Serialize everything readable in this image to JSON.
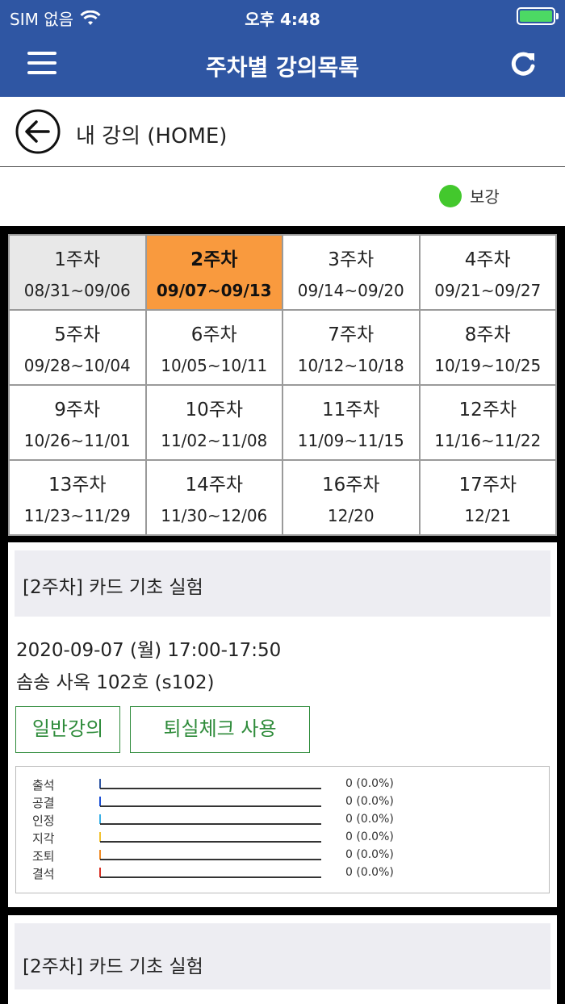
{
  "status_bar": {
    "carrier": "SIM 없음",
    "time": "오후 4:48",
    "battery_level": 1.0,
    "icons": [
      "wifi-icon",
      "battery-icon"
    ]
  },
  "navbar": {
    "title": "주차별 강의목록",
    "icons": [
      "menu-icon",
      "refresh-icon"
    ]
  },
  "back": {
    "label": "내 강의 (HOME)",
    "icon": "back-arrow-icon"
  },
  "legend": {
    "label": "보강",
    "color": "#43c82d"
  },
  "weeks": [
    {
      "week": "1주차",
      "dates": "08/31~09/06",
      "state": "past"
    },
    {
      "week": "2주차",
      "dates": "09/07~09/13",
      "state": "selected"
    },
    {
      "week": "3주차",
      "dates": "09/14~09/20",
      "state": "normal"
    },
    {
      "week": "4주차",
      "dates": "09/21~09/27",
      "state": "normal"
    },
    {
      "week": "5주차",
      "dates": "09/28~10/04",
      "state": "normal"
    },
    {
      "week": "6주차",
      "dates": "10/05~10/11",
      "state": "normal"
    },
    {
      "week": "7주차",
      "dates": "10/12~10/18",
      "state": "normal"
    },
    {
      "week": "8주차",
      "dates": "10/19~10/25",
      "state": "normal"
    },
    {
      "week": "9주차",
      "dates": "10/26~11/01",
      "state": "normal"
    },
    {
      "week": "10주차",
      "dates": "11/02~11/08",
      "state": "normal"
    },
    {
      "week": "11주차",
      "dates": "11/09~11/15",
      "state": "normal"
    },
    {
      "week": "12주차",
      "dates": "11/16~11/22",
      "state": "normal"
    },
    {
      "week": "13주차",
      "dates": "11/23~11/29",
      "state": "normal"
    },
    {
      "week": "14주차",
      "dates": "11/30~12/06",
      "state": "normal"
    },
    {
      "week": "16주차",
      "dates": "12/20",
      "state": "normal"
    },
    {
      "week": "17주차",
      "dates": "12/21",
      "state": "normal"
    }
  ],
  "lectures": [
    {
      "title": "[2주차] 카드 기초 실험",
      "datetime": "2020-09-07 (월) 17:00-17:50",
      "room": "솜송 사옥 102호 (s102)",
      "buttons": [
        "일반강의",
        "퇴실체크 사용"
      ],
      "stats": [
        {
          "label": "출석",
          "value": "0 (0.0%)",
          "color": "#2f56a3"
        },
        {
          "label": "공결",
          "value": "0 (0.0%)",
          "color": "#1a4fd6"
        },
        {
          "label": "인정",
          "value": "0 (0.0%)",
          "color": "#3ab0e6"
        },
        {
          "label": "지각",
          "value": "0 (0.0%)",
          "color": "#f2c230"
        },
        {
          "label": "조퇴",
          "value": "0 (0.0%)",
          "color": "#f08a24"
        },
        {
          "label": "결석",
          "value": "0 (0.0%)",
          "color": "#d93025"
        }
      ]
    },
    {
      "title": "[2주차] 카드 기초 실험"
    }
  ]
}
